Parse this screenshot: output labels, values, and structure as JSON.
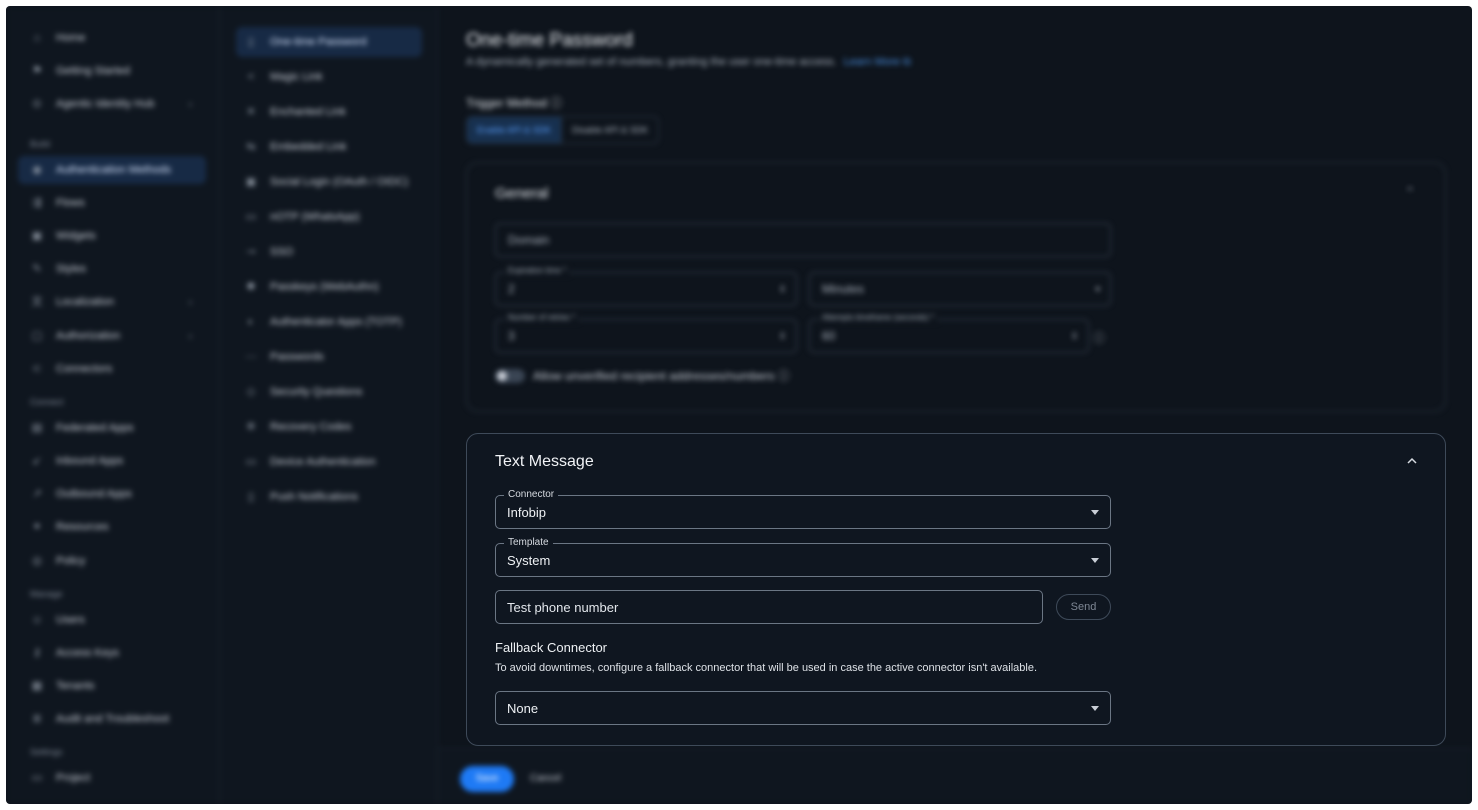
{
  "nav": {
    "items": [
      {
        "label": "Home",
        "icon": "home-icon",
        "glyph": "⌂"
      },
      {
        "label": "Getting Started",
        "icon": "flag-icon",
        "glyph": "⚑"
      },
      {
        "label": "Agentic Identity Hub",
        "icon": "hub-icon",
        "glyph": "⊙"
      }
    ],
    "build_section": "Build",
    "build_items": [
      {
        "label": "Authentication Methods",
        "icon": "fingerprint-icon",
        "glyph": "◉"
      },
      {
        "label": "Flows",
        "icon": "flows-icon",
        "glyph": "⇶"
      },
      {
        "label": "Widgets",
        "icon": "widgets-icon",
        "glyph": "▣"
      },
      {
        "label": "Styles",
        "icon": "brush-icon",
        "glyph": "✎"
      },
      {
        "label": "Localization",
        "icon": "language-icon",
        "glyph": "文"
      },
      {
        "label": "Authorization",
        "icon": "lock-icon",
        "glyph": "▢"
      },
      {
        "label": "Connectors",
        "icon": "connector-icon",
        "glyph": "⊂"
      }
    ],
    "connect_section": "Connect",
    "connect_items": [
      {
        "label": "Federated Apps",
        "icon": "apps-icon",
        "glyph": "▤"
      },
      {
        "label": "Inbound Apps",
        "icon": "inbound-icon",
        "glyph": "↙"
      },
      {
        "label": "Outbound Apps",
        "icon": "outbound-icon",
        "glyph": "↗"
      },
      {
        "label": "Resources",
        "icon": "resources-icon",
        "glyph": "✦"
      },
      {
        "label": "Policy",
        "icon": "policy-icon",
        "glyph": "◎"
      }
    ],
    "manage_section": "Manage",
    "manage_items": [
      {
        "label": "Users",
        "icon": "users-icon",
        "glyph": "☺"
      },
      {
        "label": "Access Keys",
        "icon": "key-icon",
        "glyph": "⚷"
      },
      {
        "label": "Tenants",
        "icon": "tenants-icon",
        "glyph": "▦"
      },
      {
        "label": "Audit and Troubleshoot",
        "icon": "audit-icon",
        "glyph": "≣"
      }
    ],
    "settings_section": "Settings",
    "settings_items": [
      {
        "label": "Project",
        "icon": "project-icon",
        "glyph": "▭"
      }
    ]
  },
  "methods": [
    {
      "label": "One-time Password",
      "icon": "otp-icon",
      "glyph": "▯"
    },
    {
      "label": "Magic Link",
      "icon": "magic-link-icon",
      "glyph": "<"
    },
    {
      "label": "Enchanted Link",
      "icon": "enchanted-link-icon",
      "glyph": "✕"
    },
    {
      "label": "Embedded Link",
      "icon": "embedded-link-icon",
      "glyph": "⇆"
    },
    {
      "label": "Social Login (OAuth / OIDC)",
      "icon": "social-login-icon",
      "glyph": "▣"
    },
    {
      "label": "nOTP (WhatsApp)",
      "icon": "chat-icon",
      "glyph": "▭"
    },
    {
      "label": "SSO",
      "icon": "sso-icon",
      "glyph": "⊸"
    },
    {
      "label": "Passkeys (WebAuthn)",
      "icon": "passkey-icon",
      "glyph": "✺"
    },
    {
      "label": "Authenticator Apps (TOTP)",
      "icon": "authenticator-icon",
      "glyph": "◐"
    },
    {
      "label": "Passwords",
      "icon": "password-icon",
      "glyph": "⋯"
    },
    {
      "label": "Security Questions",
      "icon": "shield-icon",
      "glyph": "◇"
    },
    {
      "label": "Recovery Codes",
      "icon": "recovery-icon",
      "glyph": "✲"
    },
    {
      "label": "Device Authentication",
      "icon": "monitor-icon",
      "glyph": "▭"
    },
    {
      "label": "Push Notifications",
      "icon": "phone-icon",
      "glyph": "▯"
    }
  ],
  "main": {
    "title": "One-time Password",
    "description": "A dynamically generated set of numbers, granting the user one-time access.",
    "learn_more": "Learn More",
    "trigger_label": "Trigger Method",
    "trigger_options": [
      "Enable API & SDK",
      "Disable API & SDK"
    ],
    "general": {
      "title": "General",
      "domain_placeholder": "Domain",
      "expiration_label": "Expiration time *",
      "expiration_value": "2",
      "unit_value": "Minutes",
      "retries_label": "Number of retries *",
      "retries_value": "3",
      "attempts_label": "Attempts timeframe (seconds) *",
      "attempts_value": "60",
      "toggle_label": "Allow unverified recipient addresses/numbers"
    }
  },
  "text_message": {
    "title": "Text Message",
    "connector_label": "Connector",
    "connector_value": "Infobip",
    "template_label": "Template",
    "template_value": "System",
    "test_phone_placeholder": "Test phone number",
    "send_label": "Send",
    "fallback_title": "Fallback Connector",
    "fallback_desc": "To avoid downtimes, configure a fallback connector that will be used in case the active connector isn't available.",
    "fallback_value": "None"
  },
  "footer": {
    "save_label": "Save",
    "cancel_label": "Cancel"
  },
  "colors": {
    "background": "#0e141c",
    "accent": "#1e7af5",
    "link": "#4a90e2"
  }
}
